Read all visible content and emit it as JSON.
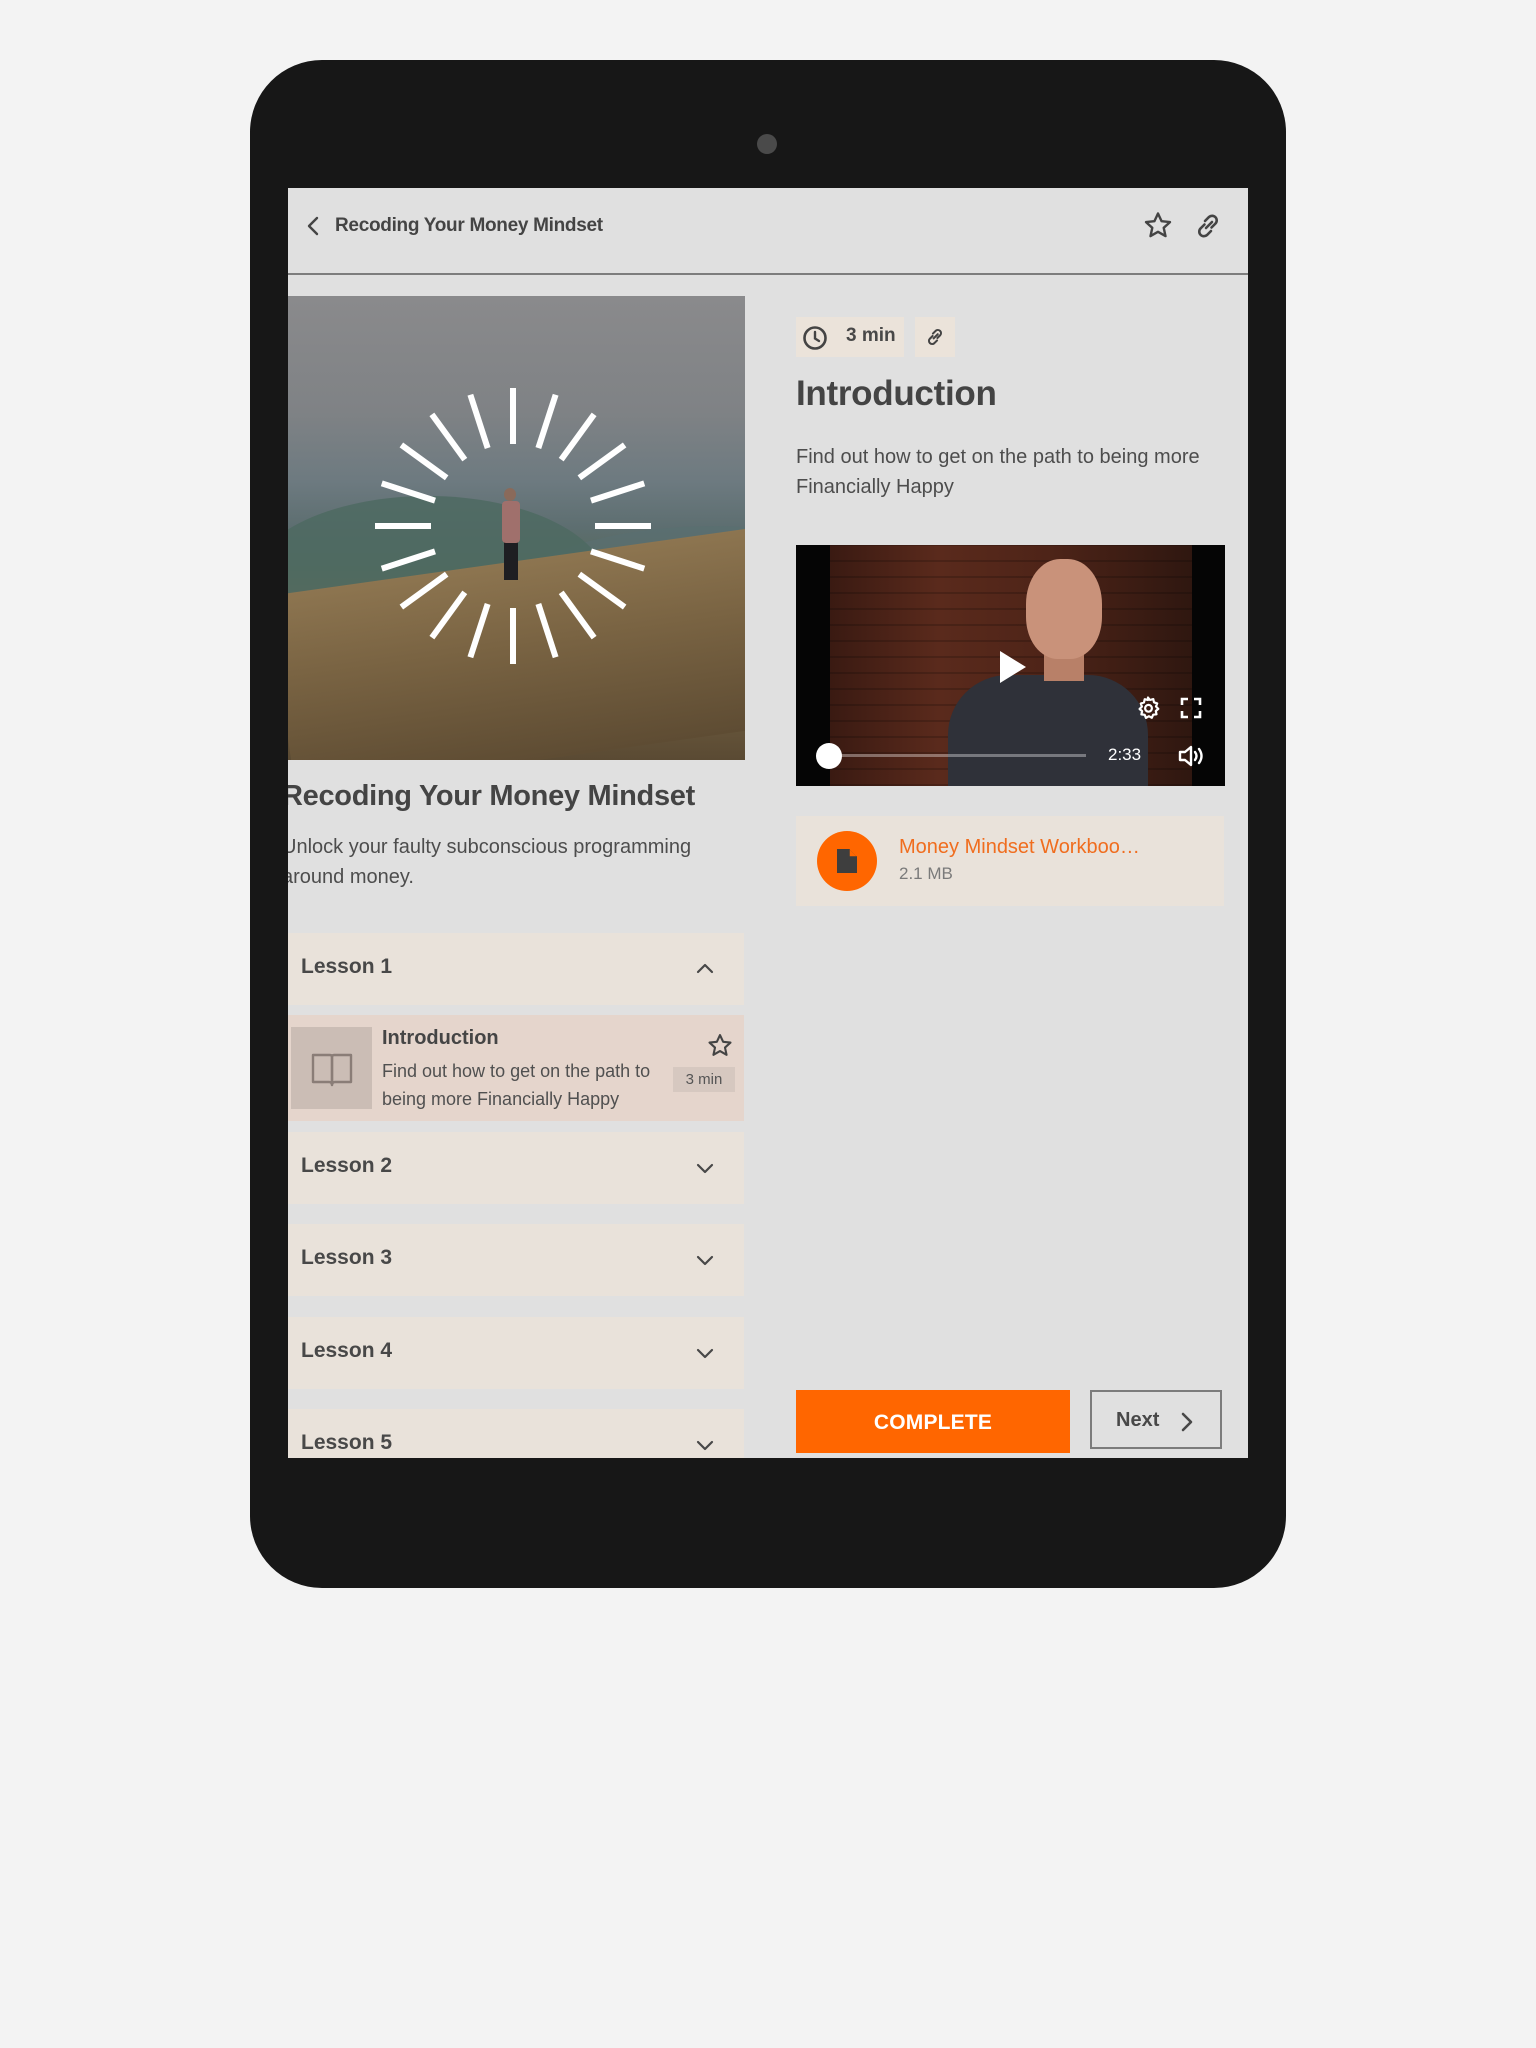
{
  "header": {
    "title": "Recoding Your Money Mindset",
    "back_icon": "chevron-left-icon",
    "favorite_icon": "star-outline-icon",
    "share_icon": "link-icon"
  },
  "course": {
    "title": "Recoding Your Money Mindset",
    "description": "Unlock your faulty subconscious programming around money.",
    "hero_image": "person-on-mountain-with-sunburst"
  },
  "lessons": [
    {
      "label": "Lesson 1",
      "expanded": true,
      "items": [
        {
          "title": "Introduction",
          "description": "Find out how to get on the path to being more Financially Happy",
          "duration": "3 min",
          "icon": "book-open-icon"
        }
      ]
    },
    {
      "label": "Lesson 2",
      "expanded": false
    },
    {
      "label": "Lesson 3",
      "expanded": false
    },
    {
      "label": "Lesson 4",
      "expanded": false
    },
    {
      "label": "Lesson 5",
      "expanded": false
    }
  ],
  "current_lesson": {
    "duration": "3 min",
    "title": "Introduction",
    "description": "Find out how to get on the path to being more Financially Happy",
    "video": {
      "time_remaining": "2:33",
      "progress": 0
    },
    "attachment": {
      "name": "Money Mindset Workboo…",
      "size": "2.1 MB",
      "icon": "document-icon"
    }
  },
  "actions": {
    "complete_label": "COMPLETE",
    "next_label": "Next"
  },
  "colors": {
    "accent": "#ff6600",
    "attachment_text": "#f06d1e",
    "lesson_bg": "#e9e2da",
    "active_item_bg": "#e5d5cc",
    "screen_bg": "#e0e0e0",
    "device": "#171717"
  }
}
